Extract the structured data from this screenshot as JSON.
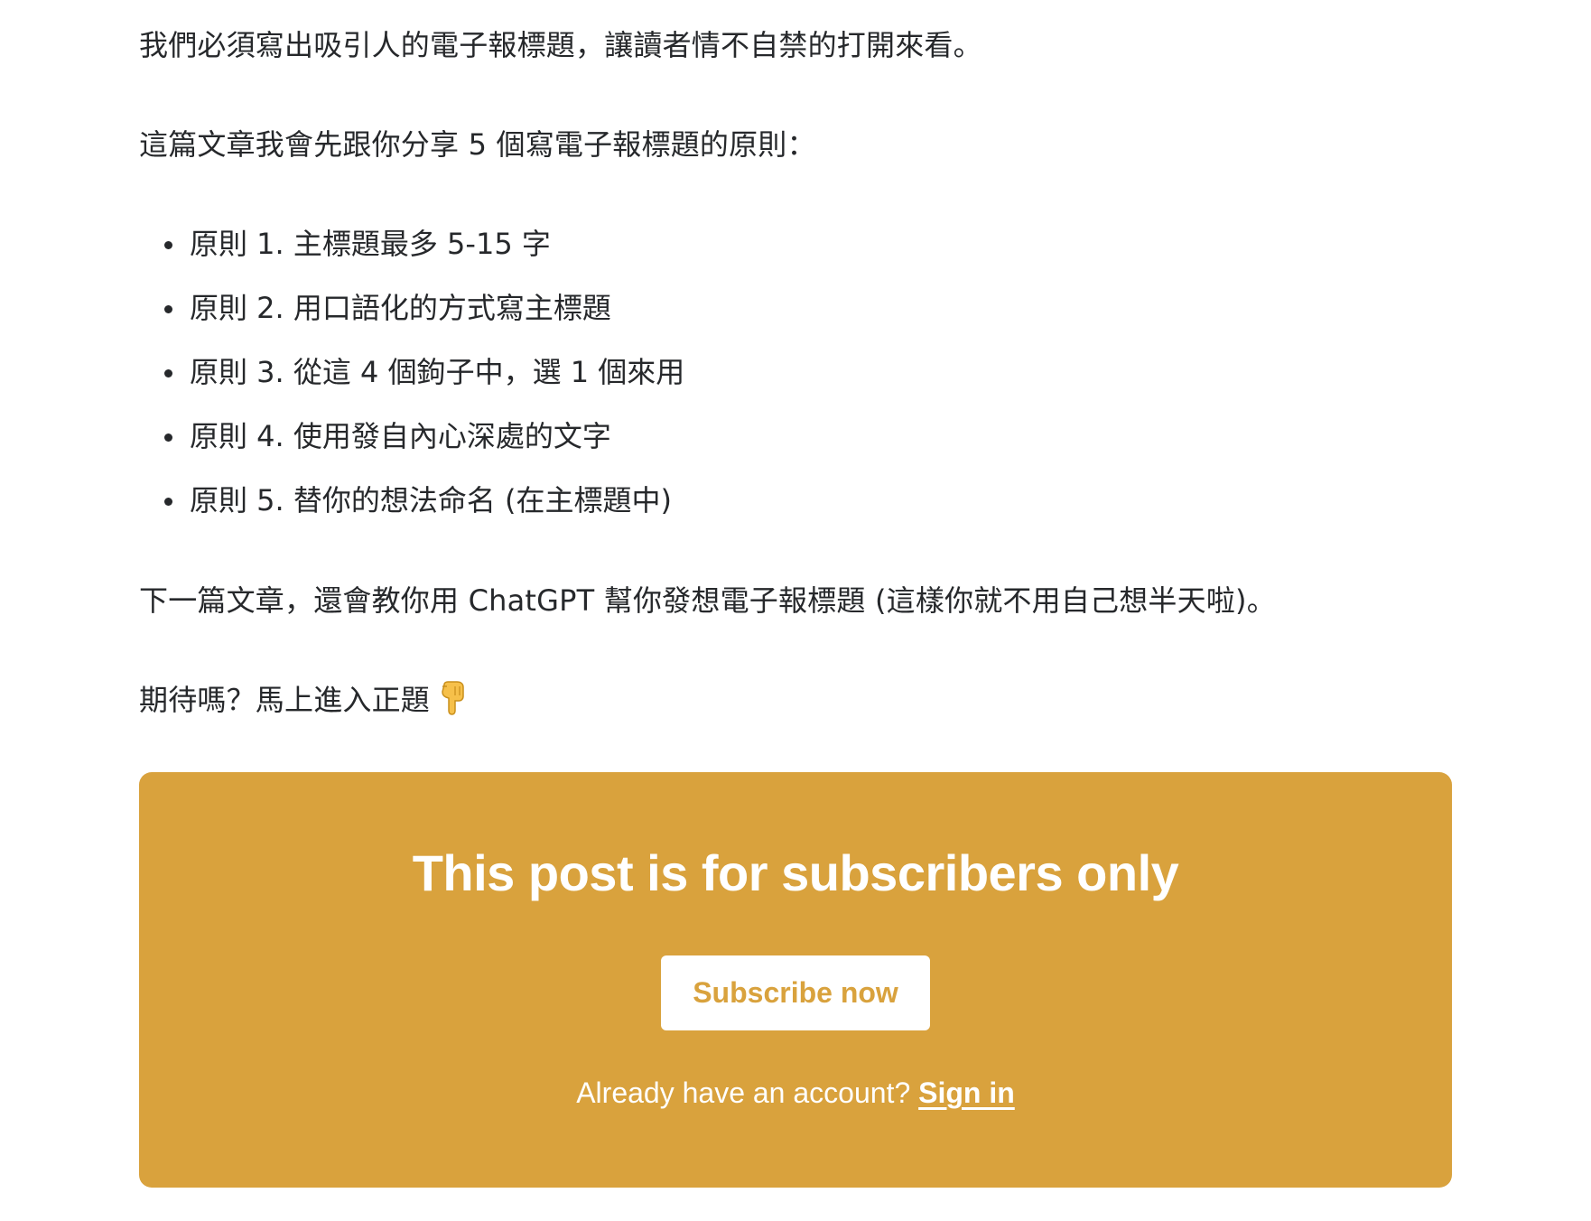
{
  "article": {
    "intro": "我們必須寫出吸引人的電子報標題，讓讀者情不自禁的打開來看。",
    "lead": "這篇文章我會先跟你分享 5 個寫電子報標題的原則：",
    "principles": [
      "原則 1. 主標題最多 5-15 字",
      "原則 2. 用口語化的方式寫主標題",
      "原則 3. 從這 4 個鉤子中，選 1 個來用",
      "原則 4. 使用發自內心深處的文字",
      "原則 5. 替你的想法命名 (在主標題中)"
    ],
    "next": "下一篇文章，還會教你用 ChatGPT 幫你發想電子報標題 (這樣你就不用自己想半天啦)。",
    "teaser": "期待嗎？馬上進入正題",
    "teaser_icon": "pointing-down-hand-icon"
  },
  "paywall": {
    "title": "This post is for subscribers only",
    "subscribe_label": "Subscribe now",
    "account_prompt": "Already have an account?",
    "signin_label": "Sign in",
    "accent_color": "#d9a23d"
  }
}
